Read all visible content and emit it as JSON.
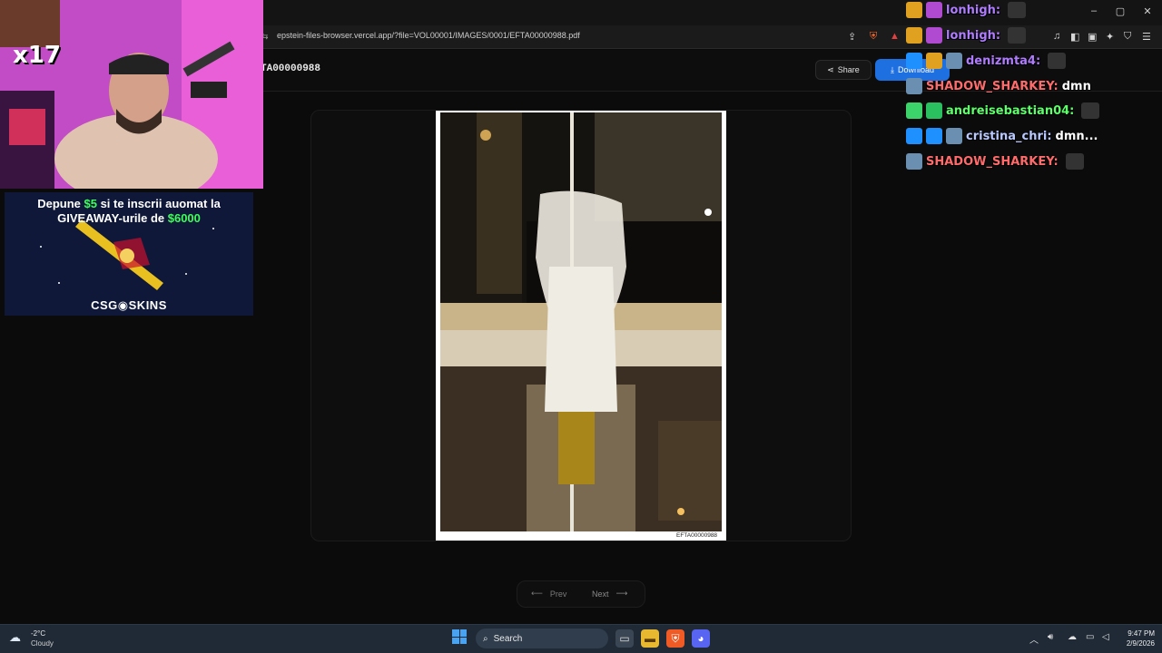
{
  "browser": {
    "url": "epstein-files-browser.vercel.app/?file=VOL00001/IMAGES/0001/EFTA00000988.pdf",
    "window_controls": [
      "–",
      "▢",
      "✕"
    ]
  },
  "page": {
    "title_partial": "TA00000988",
    "share_label": "Share",
    "download_label": "Download",
    "doc_id_label": "EFTA00000988",
    "prev_label": "Prev",
    "next_label": "Next"
  },
  "stream_overlay": {
    "counter": "x17",
    "ad": {
      "line1_prefix": "Depune ",
      "line1_amount": "$5",
      "line1_suffix": " si te inscrii auomat la",
      "line2_prefix": "GIVEAWAY-urile de ",
      "line2_amount": "$6000",
      "brand": "CSG◉SKINS"
    },
    "chat": [
      {
        "user": "lonhigh:",
        "color": "#b07cff",
        "message": "",
        "badges": [
          "#e0a020",
          "#b04ad0"
        ]
      },
      {
        "user": "lonhigh:",
        "color": "#b07cff",
        "message": "",
        "badges": [
          "#e0a020",
          "#b04ad0"
        ]
      },
      {
        "user": "denizmta4:",
        "color": "#b07cff",
        "message": "",
        "badges": [
          "#1e90ff",
          "#e0a020",
          "#6a8fb0"
        ]
      },
      {
        "user": "SHADOW_SHARKEY:",
        "color": "#ff6b6b",
        "message": "dmn",
        "badges": [
          "#6a8fb0"
        ]
      },
      {
        "user": "andreisebastian04:",
        "color": "#5dff6a",
        "message": "",
        "badges": [
          "#3bd36a",
          "#2ac060"
        ]
      },
      {
        "user": "cristina_chri:",
        "color": "#b9c9ff",
        "message": "dmn...",
        "badges": [
          "#1e90ff",
          "#1e90ff",
          "#6a8fb0"
        ]
      },
      {
        "user": "SHADOW_SHARKEY:",
        "color": "#ff6b6b",
        "message": "",
        "badges": [
          "#6a8fb0"
        ]
      }
    ]
  },
  "taskbar": {
    "weather_temp": "-2°C",
    "weather_desc": "Cloudy",
    "search_label": "Search",
    "time": "9:47 PM",
    "date": "2/9/2026"
  }
}
